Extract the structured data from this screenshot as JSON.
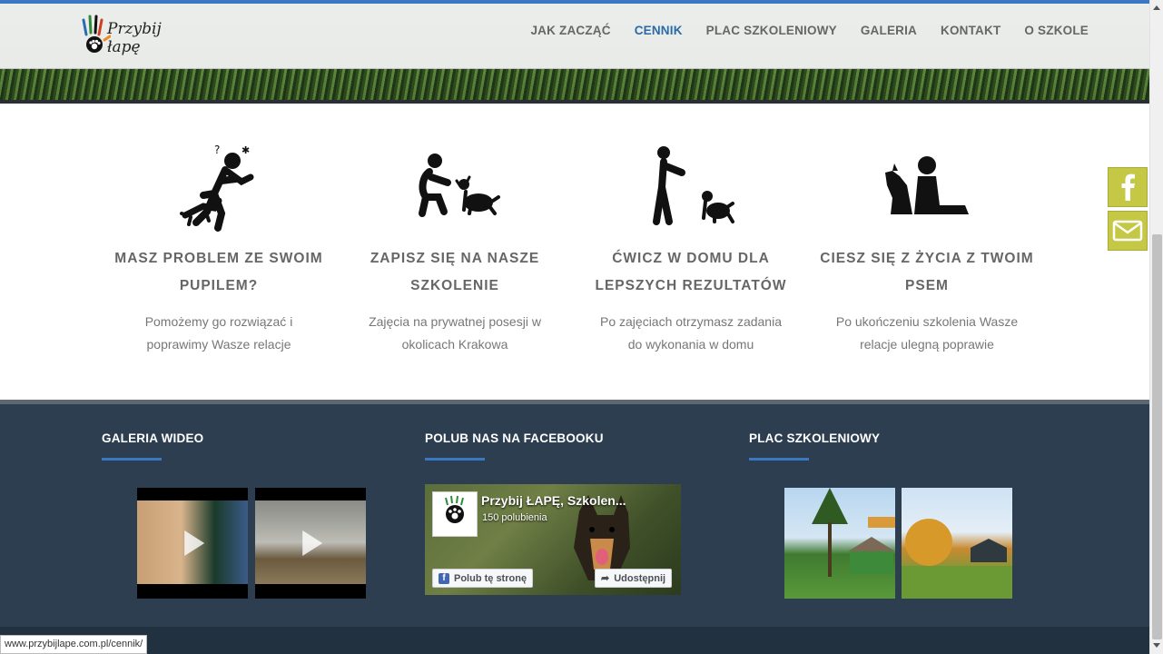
{
  "nav": {
    "logo_text": "Przybij łapę",
    "items": [
      {
        "label": "JAK ZACZĄĆ",
        "active": false
      },
      {
        "label": "CENNIK",
        "active": true
      },
      {
        "label": "PLAC SZKOLENIOWY",
        "active": false
      },
      {
        "label": "GALERIA",
        "active": false
      },
      {
        "label": "KONTAKT",
        "active": false
      },
      {
        "label": "O SZKOLE",
        "active": false
      }
    ],
    "active_color": "#2a6aa8"
  },
  "steps": [
    {
      "icon": "problem-dog-icon",
      "title": "MASZ PROBLEM ZE SWOIM PUPILEM?",
      "desc": "Pomożemy go rozwiązać i poprawimy Wasze relacje"
    },
    {
      "icon": "sign-up-training-icon",
      "title": "ZAPISZ SIĘ NA NASZE SZKOLENIE",
      "desc": "Zajęcia na prywatnej posesji w okolicach Krakowa"
    },
    {
      "icon": "practice-home-icon",
      "title": "ĆWICZ W DOMU DLA LEPSZYCH REZULTATÓW",
      "desc": "Po zajęciach otrzymasz zadania do wykonania w domu"
    },
    {
      "icon": "enjoy-life-dog-icon",
      "title": "CIESZ SIĘ Z ŻYCIA Z TWOIM PSEM",
      "desc": "Po ukończeniu szkolenia Wasze relacje ulegną poprawie"
    }
  ],
  "footer": {
    "video_title": "GALERIA WIDEO",
    "facebook_title": "POLUB NAS NA FACEBOOKU",
    "place_title": "PLAC SZKOLENIOWY",
    "accent_color": "#3a79c2",
    "facebook": {
      "page_name": "Przybij ŁAPĘ, Szkolen...",
      "likes": "150 polubienia",
      "like_button": "Polub tę stronę",
      "share_button": "Udostępnij"
    }
  },
  "social": {
    "facebook_icon": "facebook-icon",
    "mail_icon": "mail-icon",
    "color": "#c5c845"
  },
  "status_url": "www.przybijlape.com.pl/cennik/"
}
